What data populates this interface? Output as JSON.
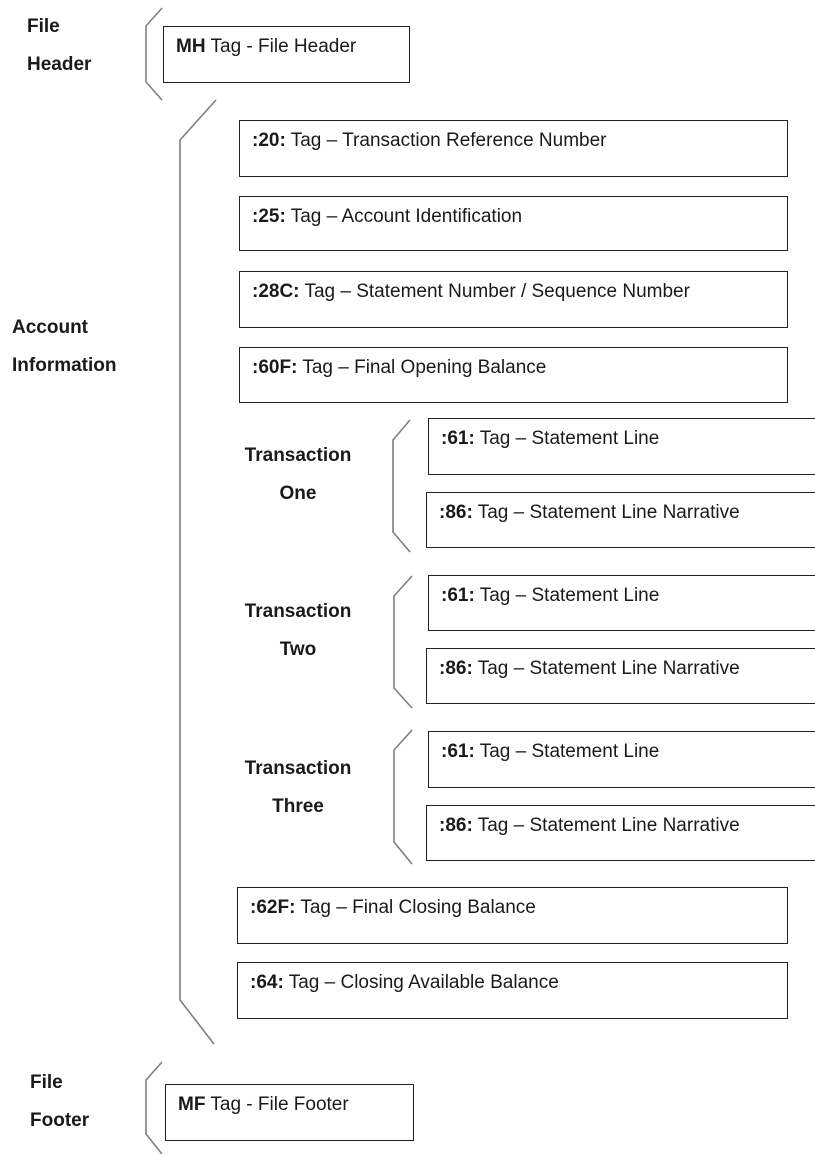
{
  "sections": {
    "header": {
      "label_lines": [
        "File",
        "Header"
      ]
    },
    "account": {
      "label_lines": [
        "Account",
        "Information"
      ]
    },
    "footer": {
      "label_lines": [
        "File",
        "Footer"
      ]
    }
  },
  "transactions": [
    {
      "label_lines": [
        "Transaction",
        "One"
      ]
    },
    {
      "label_lines": [
        "Transaction",
        "Two"
      ]
    },
    {
      "label_lines": [
        "Transaction",
        "Three"
      ]
    }
  ],
  "boxes": {
    "mh": {
      "code": "MH",
      "text": " Tag - File Header"
    },
    "t20": {
      "code": ":20:",
      "text": " Tag – Transaction Reference Number"
    },
    "t25": {
      "code": ":25:",
      "text": " Tag – Account Identification"
    },
    "t28c": {
      "code": ":28C:",
      "text": " Tag – Statement Number / Sequence Number"
    },
    "t60f": {
      "code": ":60F:",
      "text": " Tag – Final Opening Balance"
    },
    "tx1_61": {
      "code": ":61:",
      "text": " Tag – Statement Line"
    },
    "tx1_86": {
      "code": ":86:",
      "text": " Tag – Statement Line Narrative"
    },
    "tx2_61": {
      "code": ":61:",
      "text": " Tag – Statement Line"
    },
    "tx2_86": {
      "code": ":86:",
      "text": " Tag – Statement Line Narrative"
    },
    "tx3_61": {
      "code": ":61:",
      "text": " Tag – Statement Line"
    },
    "tx3_86": {
      "code": ":86:",
      "text": " Tag – Statement Line Narrative"
    },
    "t62f": {
      "code": ":62F:",
      "text": " Tag – Final Closing Balance"
    },
    "t64": {
      "code": ":64:",
      "text": " Tag – Closing Available Balance"
    },
    "mf": {
      "code": "MF",
      "text": " Tag - File Footer"
    }
  }
}
